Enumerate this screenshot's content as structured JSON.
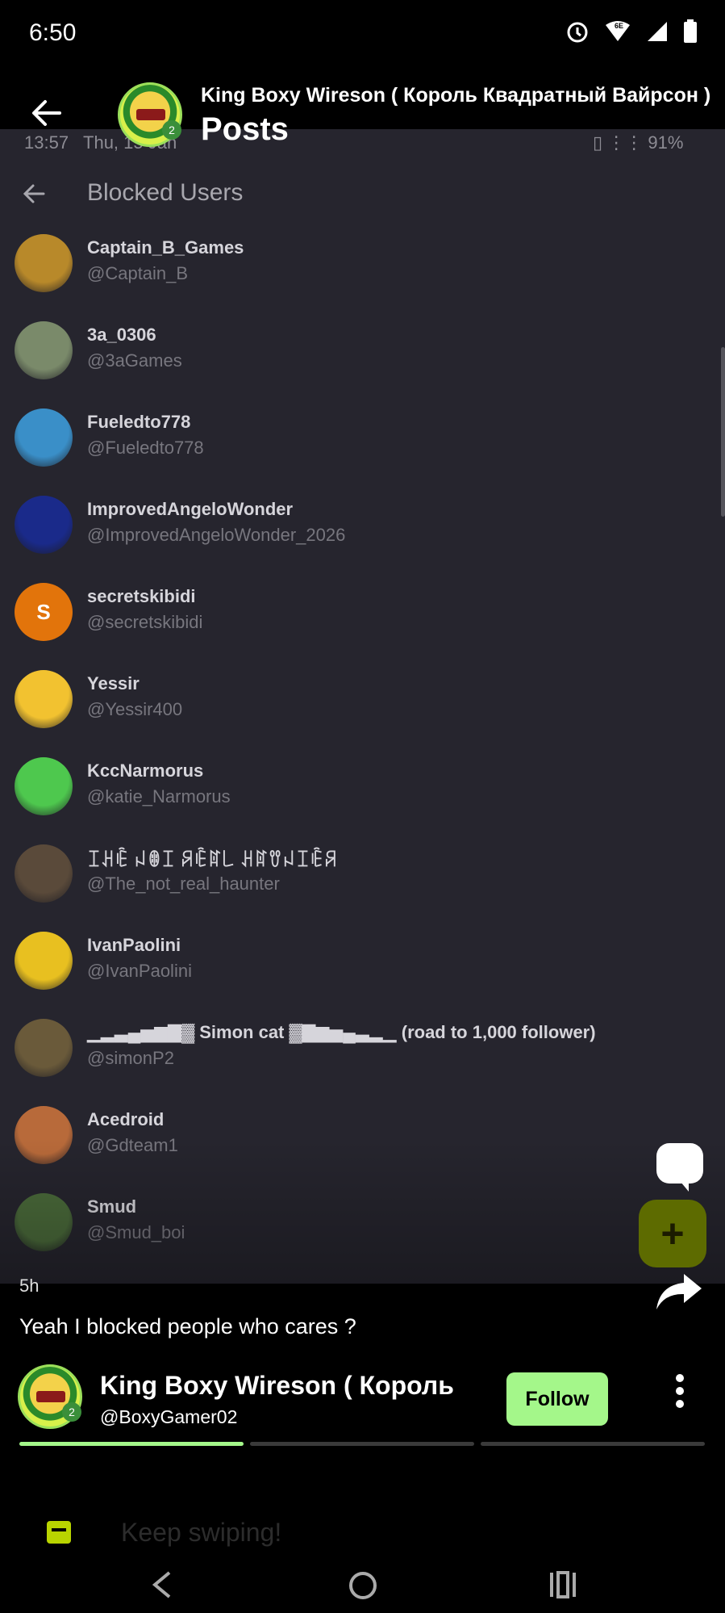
{
  "status_bar": {
    "time": "6:50",
    "icons": [
      "alarm-icon",
      "wifi-icon",
      "signal-icon",
      "battery-icon"
    ],
    "wifi_badge": "6E"
  },
  "header": {
    "author_name": "King Boxy Wireson ( Король Квадратный Вайрсон )",
    "subtitle": "Posts",
    "avatar_badge": "2"
  },
  "post_image": {
    "status_time": "13:57",
    "status_date": "Thu, 15 Jan",
    "battery": "91%",
    "title": "Blocked Users",
    "users": [
      {
        "name": "Captain_B_Games",
        "handle": "@Captain_B",
        "avatar_color": "#b8892a",
        "avatar_letter": ""
      },
      {
        "name": "3a_0306",
        "handle": "@3aGames",
        "avatar_color": "#7a8a6a",
        "avatar_letter": ""
      },
      {
        "name": "Fueledto778",
        "handle": "@Fueledto778",
        "avatar_color": "#3a8fc8",
        "avatar_letter": ""
      },
      {
        "name": "ImprovedAngeloWonder",
        "handle": "@ImprovedAngeloWonder_2026",
        "avatar_color": "#1a2a8a",
        "avatar_letter": ""
      },
      {
        "name": "secretskibidi",
        "handle": "@secretskibidi",
        "avatar_color": "#e2740b",
        "avatar_letter": "S"
      },
      {
        "name": "Yessir",
        "handle": "@Yessir400",
        "avatar_color": "#f2c230",
        "avatar_letter": ""
      },
      {
        "name": "KccNarmorus",
        "handle": "@katie_Narmorus",
        "avatar_color": "#4ec84e",
        "avatar_letter": ""
      },
      {
        "name": "ꀤꃅꍟ ꈤꂦꀤ ꋪꍟꍏ꒒ ꃅꍏꀎꈤꀤꍟꋪ",
        "handle": "@The_not_real_haunter",
        "avatar_color": "#5a4a3a",
        "avatar_letter": ""
      },
      {
        "name": "IvanPaolini",
        "handle": "@IvanPaolini",
        "avatar_color": "#e8c020",
        "avatar_letter": ""
      },
      {
        "name": "▁▂▃▄▅▆▇▓ Simon cat ▓▇▆▅▄▃▂▁ (road to 1,000 follower)",
        "handle": "@simonP2",
        "avatar_color": "#6a5a3a",
        "avatar_letter": ""
      },
      {
        "name": "Acedroid",
        "handle": "@Gdteam1",
        "avatar_color": "#b86a3a",
        "avatar_letter": ""
      },
      {
        "name": "Smud",
        "handle": "@Smud_boi",
        "avatar_color": "#4a6a3a",
        "avatar_letter": ""
      }
    ]
  },
  "post": {
    "time_ago": "5h",
    "caption": "Yeah I blocked people who cares ?",
    "author_name": "King Boxy Wireson ( Король Квадратный Вайрсон )",
    "author_handle": "@BoxyGamer02",
    "follow_label": "Follow",
    "progress_segments": [
      1,
      0,
      0
    ]
  },
  "footer": {
    "hint": "Keep swiping!"
  },
  "colors": {
    "accent_green": "#a4f78a",
    "fab_bg": "#5d6b00",
    "hint_icon": "#b9d400"
  }
}
